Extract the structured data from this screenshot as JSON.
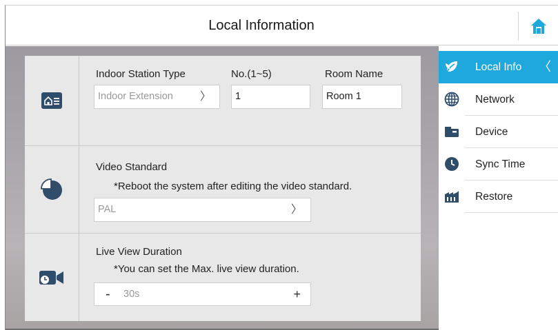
{
  "header": {
    "title": "Local Information",
    "home_icon": "home-icon"
  },
  "panels": {
    "station": {
      "icon": "station-list-icon",
      "type_label": "Indoor Station Type",
      "type_value": "Indoor Extension",
      "no_label": "No.(1~5)",
      "no_value": "1",
      "room_label": "Room Name",
      "room_value": "Room 1"
    },
    "video": {
      "icon": "pie-chart-icon",
      "label": "Video Standard",
      "note": "*Reboot the system after editing the video standard.",
      "value": "PAL"
    },
    "liveview": {
      "icon": "camera-clock-icon",
      "label": "Live View Duration",
      "note": "*You can set the Max. live view duration.",
      "value": "30s",
      "minus": "-",
      "plus": "+"
    }
  },
  "sidebar": {
    "items": [
      {
        "label": "Local Info",
        "icon": "leaf-icon",
        "active": true
      },
      {
        "label": "Network",
        "icon": "globe-icon",
        "active": false
      },
      {
        "label": "Device",
        "icon": "device-icon",
        "active": false
      },
      {
        "label": "Sync Time",
        "icon": "clock-icon",
        "active": false
      },
      {
        "label": "Restore",
        "icon": "factory-icon",
        "active": false
      }
    ]
  },
  "colors": {
    "accent": "#1fa8dc",
    "icon_dark": "#2f4d6b"
  }
}
